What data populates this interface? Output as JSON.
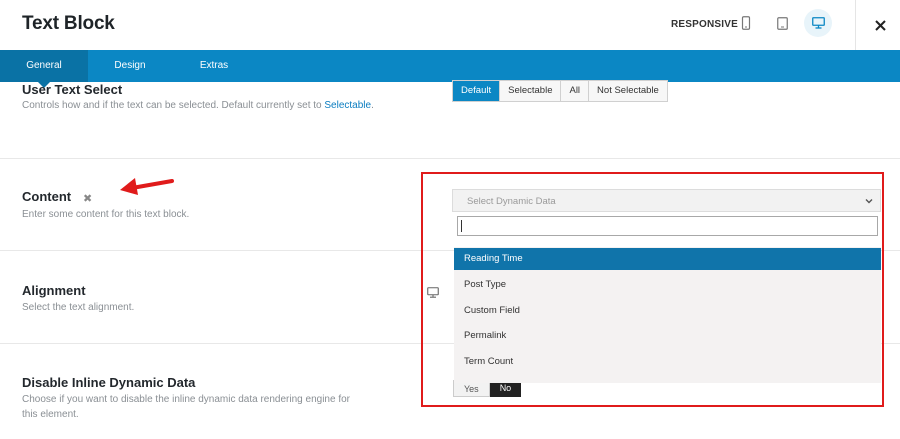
{
  "header": {
    "title": "Text Block",
    "responsive_label": "RESPONSIVE"
  },
  "tabs": [
    {
      "label": "General",
      "active": true
    },
    {
      "label": "Design",
      "active": false
    },
    {
      "label": "Extras",
      "active": false
    }
  ],
  "user_text_select": {
    "title": "User Text Select",
    "desc_prefix": "Controls how and if the text can be selected. Default currently set to",
    "desc_link": "Selectable",
    "desc_suffix": ".",
    "options": [
      "Default",
      "Selectable",
      "All",
      "Not Selectable"
    ],
    "selected": "Default"
  },
  "content": {
    "title": "Content",
    "remove_glyph": "✖",
    "desc": "Enter some content for this text block."
  },
  "alignment": {
    "title": "Alignment",
    "desc": "Select the text alignment."
  },
  "disable_inline": {
    "title": "Disable Inline Dynamic Data",
    "desc_line1": "Choose if you want to disable the inline dynamic data rendering engine for",
    "desc_line2": "this element.",
    "yes_label": "Yes",
    "no_label": "No"
  },
  "dynamic_data_dropdown": {
    "placeholder": "Select Dynamic Data",
    "search_value": "",
    "options": [
      "Reading Time",
      "Post Type",
      "Custom Field",
      "Permalink",
      "Term Count"
    ],
    "highlighted": "Reading Time"
  },
  "colors": {
    "accent": "#0b87c4",
    "annotation_red": "#e01b1b",
    "highlight": "#1074aa"
  }
}
